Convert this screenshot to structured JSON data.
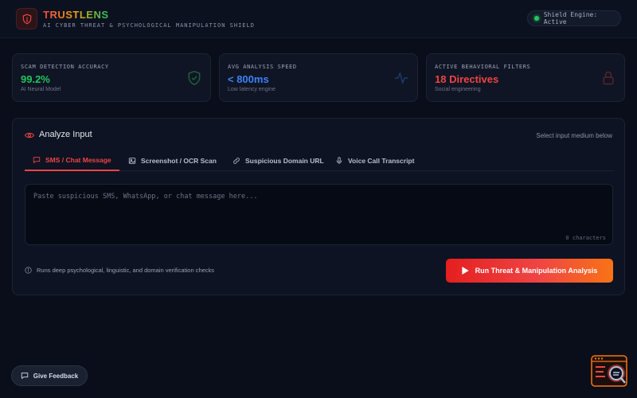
{
  "header": {
    "brand": "TRUSTLENS",
    "subtitle": "AI CYBER THREAT & PSYCHOLOGICAL MANIPULATION SHIELD",
    "engine_status": "Shield Engine: Active"
  },
  "stats": [
    {
      "label": "SCAM DETECTION ACCURACY",
      "value": "99.2%",
      "sub": "AI Neural Model",
      "color": "#22c55e",
      "icon": "shield-check-icon"
    },
    {
      "label": "AVG ANALYSIS SPEED",
      "value": "< 800ms",
      "sub": "Low latency engine",
      "color": "#3b82f6",
      "icon": "pulse-icon"
    },
    {
      "label": "ACTIVE BEHAVIORAL FILTERS",
      "value": "18 Directives",
      "sub": "Social engineering",
      "color": "#ef4444",
      "icon": "lock-icon"
    }
  ],
  "panel": {
    "title": "Analyze Input",
    "hint": "Select input medium below",
    "tabs": [
      {
        "label": "SMS / Chat Message",
        "icon": "message-icon",
        "active": true
      },
      {
        "label": "Screenshot / OCR Scan",
        "icon": "image-icon",
        "active": false
      },
      {
        "label": "Suspicious Domain URL",
        "icon": "link-icon",
        "active": false
      },
      {
        "label": "Voice Call Transcript",
        "icon": "mic-icon",
        "active": false
      }
    ],
    "input_placeholder": "Paste suspicious SMS, WhatsApp, or chat message here...",
    "char_count": "0 characters",
    "info_text": "Runs deep psychological, linguistic, and domain verification checks",
    "run_button": "Run Threat & Manipulation Analysis"
  },
  "feedback_button": "Give Feedback",
  "colors": {
    "background": "#0a0e1a",
    "accent_red": "#ef4444",
    "accent_orange": "#f97316",
    "accent_green": "#22c55e",
    "accent_blue": "#3b82f6"
  }
}
